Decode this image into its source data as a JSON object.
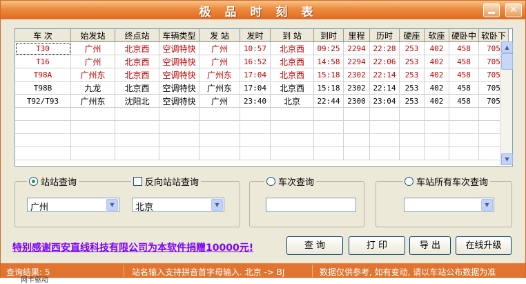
{
  "window": {
    "title": "极品时刻表"
  },
  "table": {
    "columns": [
      "车  次",
      "始发站",
      "终点站",
      "车辆类型",
      "发  站",
      "发时",
      "到  站",
      "到时",
      "里程",
      "历时",
      "硬座",
      "软座",
      "硬卧中",
      "软卧下"
    ],
    "rows": [
      {
        "cells": [
          "T30",
          "广州",
          "北京西",
          "空调特快",
          "广州",
          "10:57",
          "北京西",
          "09:25",
          "2294",
          "22:28",
          "253",
          "402",
          "458",
          "705"
        ],
        "color": "red"
      },
      {
        "cells": [
          "T16",
          "广州",
          "北京西",
          "空调特快",
          "广州",
          "16:52",
          "北京西",
          "14:58",
          "2294",
          "22:06",
          "253",
          "402",
          "458",
          "705"
        ],
        "color": "red"
      },
      {
        "cells": [
          "T98A",
          "广州东",
          "北京西",
          "空调特快",
          "广州东",
          "17:04",
          "北京西",
          "15:18",
          "2302",
          "22:14",
          "253",
          "402",
          "458",
          "705"
        ],
        "color": "red"
      },
      {
        "cells": [
          "T98B",
          "九龙",
          "北京西",
          "空调特快",
          "广州东",
          "17:04",
          "北京西",
          "15:18",
          "2302",
          "22:14",
          "253",
          "402",
          "458",
          "705"
        ],
        "color": "black"
      },
      {
        "cells": [
          "T92/T93",
          "广州东",
          "沈阳北",
          "空调特快",
          "广州",
          "23:40",
          "北京",
          "22:44",
          "2300",
          "23:04",
          "253",
          "402",
          "458",
          "705"
        ],
        "color": "black"
      }
    ],
    "empty_rows": 4
  },
  "query": {
    "station_to_station": {
      "label": "站站查询",
      "from_value": "广州"
    },
    "reverse": {
      "label": "反向站站查询",
      "to_value": "北京"
    },
    "train_no": {
      "label": "车次查询",
      "value": ""
    },
    "station_all": {
      "label": "车站所有车次查询",
      "value": ""
    }
  },
  "thanks": "特别感谢西安直线科技有限公司为本软件捐赠10000元!",
  "buttons": {
    "query": "查  询",
    "print": "打  印",
    "export": "导 出",
    "upgrade": "在线升级"
  },
  "status": {
    "result": "查询结果: 5",
    "hint": "站名输入支持拼音首字母输入.  北京 -> BJ",
    "note": "数据仅供参考, 如有变动, 请以车站公布数据为准"
  },
  "taskbar_hint": "网卡驱动",
  "colors": {
    "title": "#e07430",
    "red_text": "#c00000",
    "thanks": "#7b00ff"
  }
}
